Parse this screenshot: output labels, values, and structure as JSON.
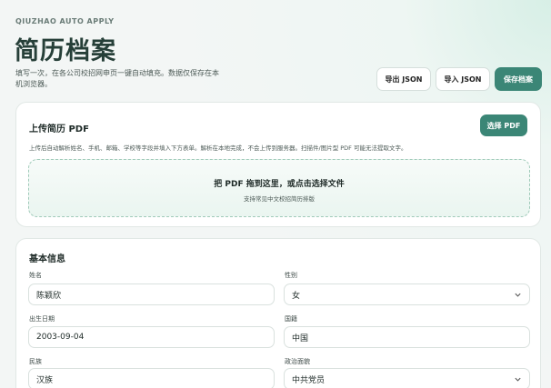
{
  "header": {
    "brand": "QIUZHAO AUTO APPLY",
    "title": "简历档案",
    "description": "填写一次，在各公司校招网申页一键自动填充。数据仅保存在本机浏览器。",
    "export_label": "导出 JSON",
    "import_label": "导入 JSON",
    "save_label": "保存档案"
  },
  "upload": {
    "title": "上传简历 PDF",
    "select_label": "选择 PDF",
    "hint": "上传后自动解析姓名、手机、邮箱、学校等字段并填入下方表单。解析在本地完成，不会上传到服务器。扫描件/图片型 PDF 可能无法提取文字。",
    "drop_main": "把 PDF 拖到这里，或点击选择文件",
    "drop_sub": "支持常见中文校招简历排版"
  },
  "basic": {
    "title": "基本信息",
    "name_label": "姓名",
    "name_value": "陈颖欣",
    "gender_label": "性别",
    "gender_value": "女",
    "birth_label": "出生日期",
    "birth_value": "2003-09-04",
    "nationality_label": "国籍",
    "nationality_value": "中国",
    "ethnicity_label": "民族",
    "ethnicity_value": "汉族",
    "political_label": "政治面貌",
    "political_value": "中共党员"
  }
}
